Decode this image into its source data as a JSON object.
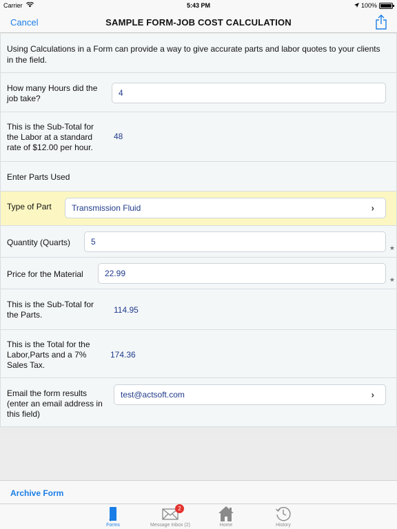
{
  "status": {
    "carrier": "Carrier",
    "time": "5:43 PM",
    "battery": "100%"
  },
  "nav": {
    "cancel_label": "Cancel",
    "title": "SAMPLE FORM-JOB COST CALCULATION",
    "share_icon": "share-icon"
  },
  "form": {
    "intro": "Using Calculations in a Form can provide a way to give accurate parts and labor quotes to your clients in the field.",
    "hours_label": "How many Hours did the job take?",
    "hours_value": "4",
    "labor_subtotal_label": "This is the Sub-Total for the Labor at a standard rate of $12.00 per hour.",
    "labor_subtotal_value": "48",
    "parts_header": "Enter Parts Used",
    "part_type_label": "Type of Part",
    "part_type_value": "Transmission Fluid",
    "quantity_label": "Quantity (Quarts)",
    "quantity_value": "5",
    "price_label": "Price for the Material",
    "price_value": "22.99",
    "parts_subtotal_label": "This is the Sub-Total for the Parts.",
    "parts_subtotal_value": "114.95",
    "total_label": "This is the Total for the Labor,Parts and a 7% Sales Tax.",
    "total_value": "174.36",
    "email_label": "Email the form results (enter an email address in this field)",
    "email_value": "test@actsoft.com",
    "required_marker": "★"
  },
  "archive_label": "Archive Form",
  "tabs": [
    {
      "label": "Forms",
      "icon": "forms-icon",
      "active": true
    },
    {
      "label": "Message Inbox (2)",
      "icon": "envelope-icon",
      "badge": "2"
    },
    {
      "label": "Home",
      "icon": "home-icon"
    },
    {
      "label": "History",
      "icon": "history-icon"
    }
  ],
  "colors": {
    "accent": "#1a7ee6",
    "value_text": "#1f3a8a",
    "highlight_row": "#fcf7c2",
    "badge": "#e5312d"
  }
}
